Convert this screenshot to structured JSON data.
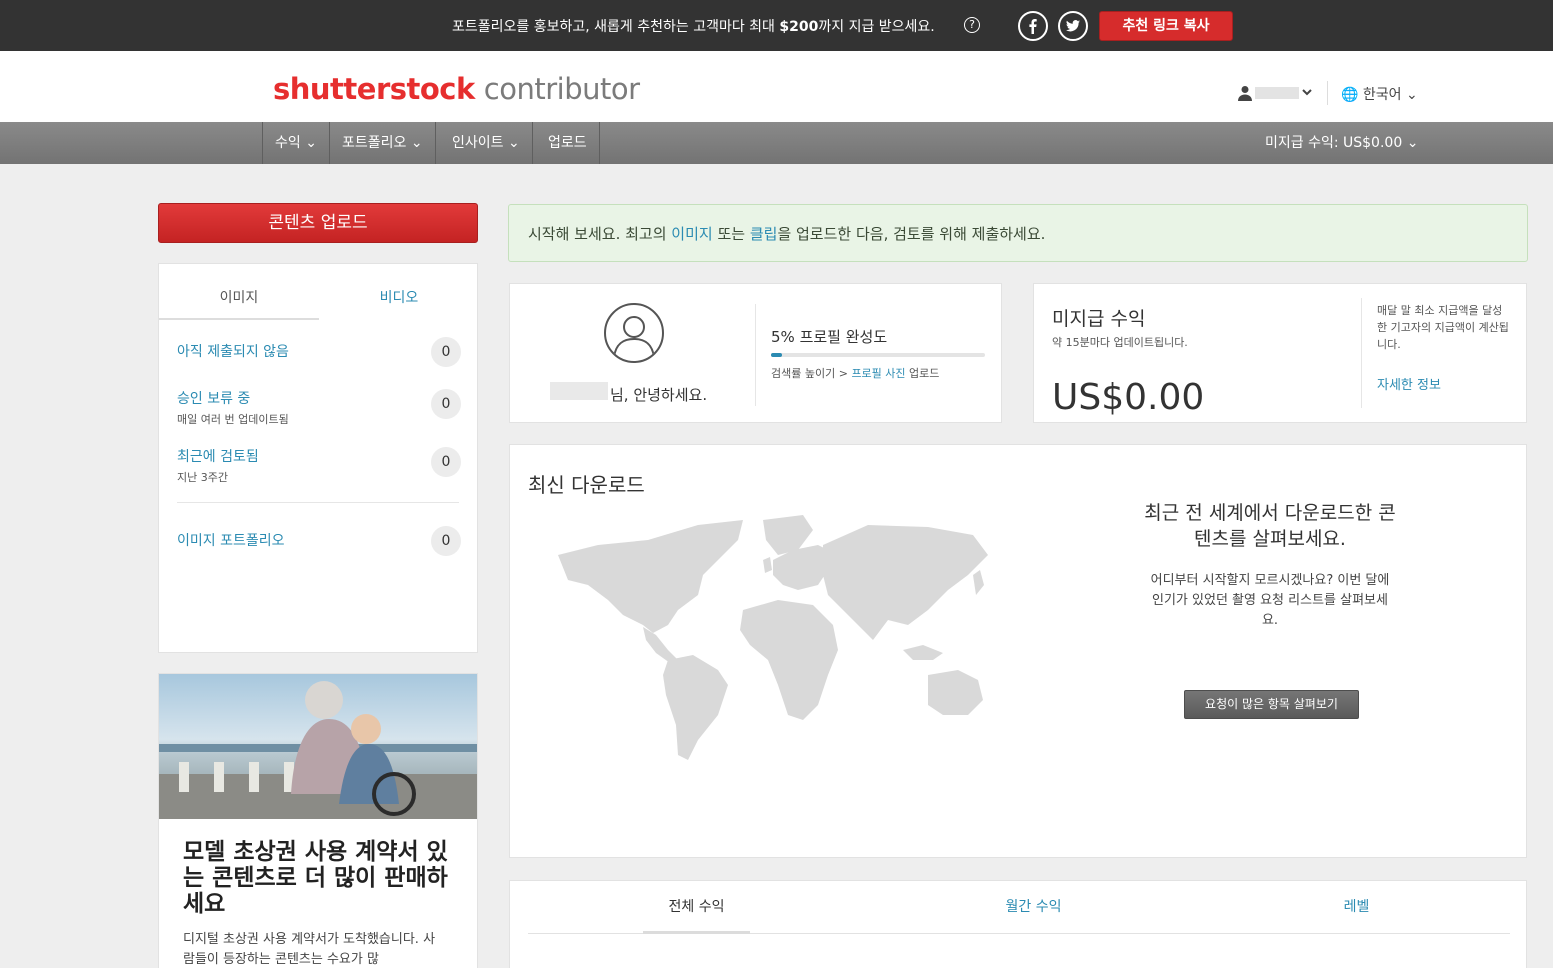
{
  "colors": {
    "brand_red": "#e62e2e",
    "link_blue": "#2b8bb2",
    "topbar": "#333333",
    "nav_gray": "#7d7d7d",
    "alert_green": "#e9f4e6"
  },
  "promo_bar": {
    "text_before": "포트폴리오를 홍보하고, 새롭게 추천하는 고객마다 최대 ",
    "text_amount": "$200",
    "text_after": "까지 지급 받으세요.",
    "help_icon": "?",
    "copy_button": "추천 링크 복사"
  },
  "header": {
    "logo_brand": "shutterstock",
    "logo_product": "contributor",
    "language": "한국어"
  },
  "nav": {
    "items": [
      {
        "label": "수익 ⌄"
      },
      {
        "label": "포트폴리오 ⌄"
      },
      {
        "label": "인사이트 ⌄"
      },
      {
        "label": "업로드"
      }
    ],
    "unpaid_earnings": "미지급 수익: US$0.00"
  },
  "sidebar": {
    "upload_button": "콘텐츠 업로드",
    "tabs": {
      "images": "이미지",
      "video": "비디오"
    },
    "stats": [
      {
        "label": "아직 제출되지 않음",
        "sub": "",
        "count": "0"
      },
      {
        "label": "승인 보류 중",
        "sub": "매일 여러 번 업데이트됨",
        "count": "0"
      },
      {
        "label": "최근에 검토됨",
        "sub": "지난 3주간",
        "count": "0"
      },
      {
        "label": "이미지 포트폴리오",
        "sub": "",
        "count": "0"
      }
    ],
    "promo": {
      "title": "모델 초상권 사용 계약서 있는 콘텐츠로 더 많이 판매하세요",
      "desc": "디지털 초상권 사용 계약서가 도착했습니다. 사람들이 등장하는 콘텐츠는 수요가 많"
    }
  },
  "alert": {
    "text_1": "시작해 보세요. 최고의 ",
    "link_images": "이미지",
    "text_2": " 또는 ",
    "link_clips": "클립",
    "text_3": "을 업로드한 다음, 검토를 위해 제출하세요."
  },
  "profile": {
    "greeting": "님, 안녕하세요.",
    "completion_label": "5% 프로필 완성도",
    "completion": 0.05,
    "boost_text": "검색률 높이기 > ",
    "boost_link": "프로필 사진",
    "boost_after": " 업로드"
  },
  "earnings": {
    "title": "미지급 수익",
    "sub": "약 15분마다 업데이트됩니다.",
    "amount": "US$0.00",
    "note": "매달 말 최소 지급액을 달성한 기고자의 지급액이 계산됩니다.",
    "more_link": "자세한 정보"
  },
  "downloads": {
    "title": "최신 다운로드",
    "headline": "최근 전 세계에서 다운로드한 콘텐츠를 살펴보세요.",
    "body": "어디부터 시작할지 모르시겠나요? 이번 달에 인기가 있었던 촬영 요청 리스트를 살펴보세요.",
    "button": "요청이 많은 항목 살펴보기"
  },
  "bottom_tabs": {
    "total": "전체 수익",
    "monthly": "월간 수익",
    "level": "레벨"
  }
}
